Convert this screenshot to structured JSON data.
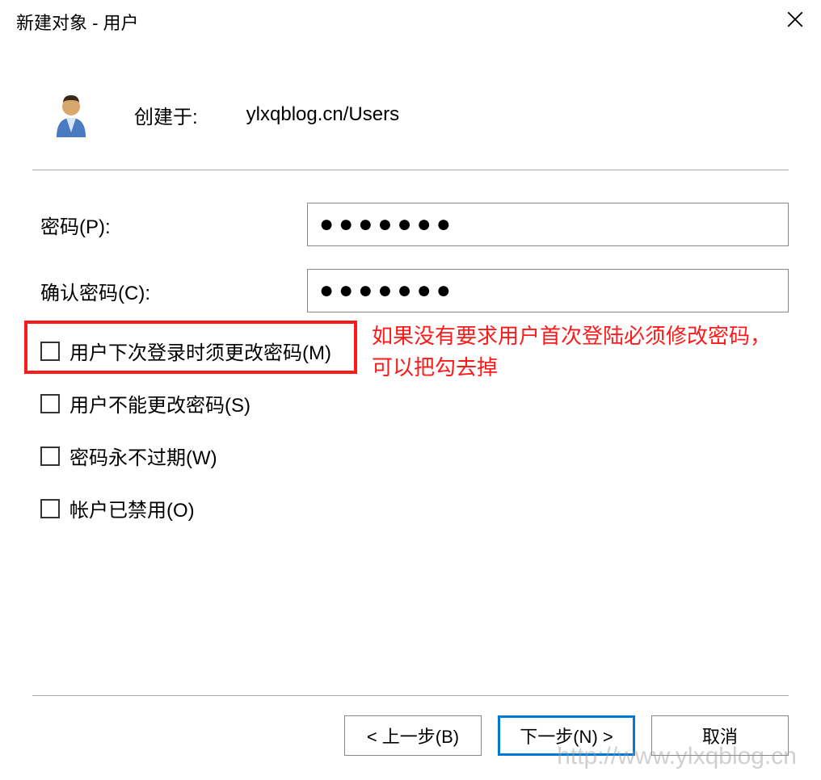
{
  "titlebar": {
    "title": "新建对象 - 用户"
  },
  "header": {
    "created_label": "创建于:",
    "created_path": "ylxqblog.cn/Users"
  },
  "form": {
    "password_label": "密码(P):",
    "password_value": "●●●●●●●",
    "confirm_label": "确认密码(C):",
    "confirm_value": "●●●●●●●"
  },
  "checkboxes": {
    "must_change": "用户下次登录时须更改密码(M)",
    "cannot_change": "用户不能更改密码(S)",
    "never_expires": "密码永不过期(W)",
    "disabled": "帐户已禁用(O)"
  },
  "annotation": "如果没有要求用户首次登陆必须修改密码，可以把勾去掉",
  "buttons": {
    "back": "< 上一步(B)",
    "next": "下一步(N) >",
    "cancel": "取消"
  },
  "watermark": "http://www.ylxqblog.cn"
}
